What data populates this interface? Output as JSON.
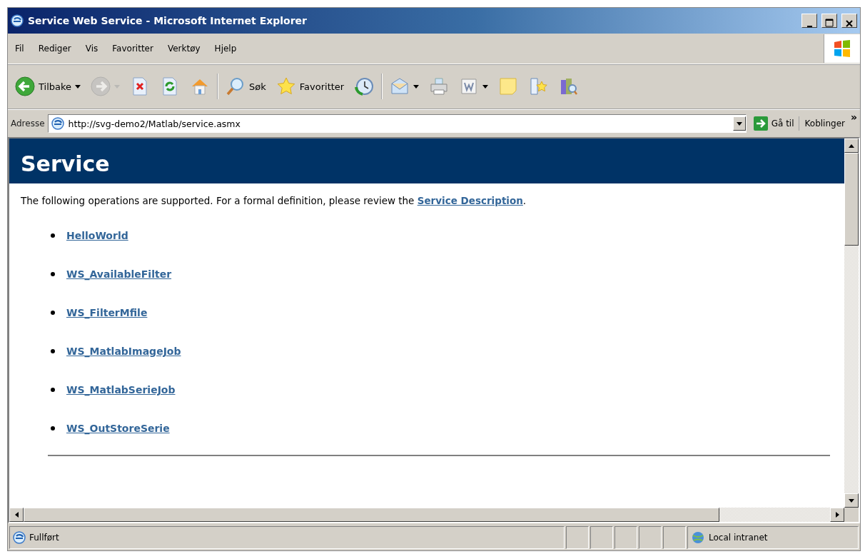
{
  "window": {
    "title": "Service Web Service - Microsoft Internet Explorer"
  },
  "menu": [
    "Fil",
    "Rediger",
    "Vis",
    "Favoritter",
    "Verktøy",
    "Hjelp"
  ],
  "toolbar": [
    {
      "kind": "back",
      "label": "Tilbake",
      "dropdown": true,
      "disabled": false
    },
    {
      "kind": "forward",
      "dropdown": true,
      "disabled": true
    },
    {
      "kind": "stop",
      "dropdown": false,
      "disabled": false
    },
    {
      "kind": "refresh",
      "dropdown": false,
      "disabled": false
    },
    {
      "kind": "home",
      "dropdown": false,
      "disabled": false
    },
    {
      "kind": "separator"
    },
    {
      "kind": "search",
      "label": "Søk",
      "dropdown": false,
      "disabled": false
    },
    {
      "kind": "favorites",
      "label": "Favoritter",
      "dropdown": false,
      "disabled": false
    },
    {
      "kind": "history",
      "dropdown": false,
      "disabled": false
    },
    {
      "kind": "separator"
    },
    {
      "kind": "mail",
      "dropdown": true,
      "disabled": false
    },
    {
      "kind": "print",
      "dropdown": false,
      "disabled": false
    },
    {
      "kind": "edit",
      "dropdown": true,
      "disabled": false
    },
    {
      "kind": "note",
      "dropdown": false,
      "disabled": false
    },
    {
      "kind": "messenger",
      "dropdown": false,
      "disabled": false
    },
    {
      "kind": "research",
      "dropdown": false,
      "disabled": false
    }
  ],
  "address": {
    "label": "Adresse",
    "value": "http://svg-demo2/Matlab/service.asmx",
    "go": "Gå til",
    "links": "Koblinger",
    "more": "»"
  },
  "page": {
    "heading": "Service",
    "intro": {
      "before": "The following operations are supported. For a formal definition, please review the ",
      "link": "Service Description",
      "after": "."
    },
    "operations": [
      "HelloWorld",
      "WS_AvailableFilter",
      "WS_FilterMfile",
      "WS_MatlabImageJob",
      "WS_MatlabSerieJob",
      "WS_OutStoreSerie"
    ]
  },
  "status_bar": {
    "text": "Fullført",
    "zone": "Local intranet"
  }
}
